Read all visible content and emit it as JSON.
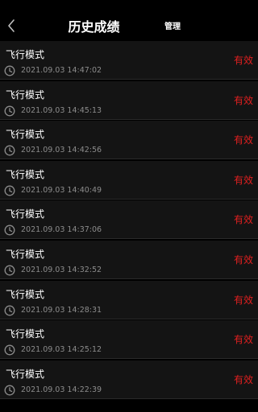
{
  "header": {
    "title": "历史成绩",
    "manage_label": "管理"
  },
  "colors": {
    "status": "#e02020"
  },
  "records": [
    {
      "name": "飞行模式",
      "time": "2021.09.03 14:47:02",
      "status": "有效"
    },
    {
      "name": "飞行模式",
      "time": "2021.09.03 14:45:13",
      "status": "有效"
    },
    {
      "name": "飞行模式",
      "time": "2021.09.03 14:42:56",
      "status": "有效"
    },
    {
      "name": "飞行模式",
      "time": "2021.09.03 14:40:49",
      "status": "有效"
    },
    {
      "name": "飞行模式",
      "time": "2021.09.03 14:37:06",
      "status": "有效"
    },
    {
      "name": "飞行模式",
      "time": "2021.09.03 14:32:52",
      "status": "有效"
    },
    {
      "name": "飞行模式",
      "time": "2021.09.03 14:28:31",
      "status": "有效"
    },
    {
      "name": "飞行模式",
      "time": "2021.09.03 14:25:12",
      "status": "有效"
    },
    {
      "name": "飞行模式",
      "time": "2021.09.03 14:22:39",
      "status": "有效"
    }
  ]
}
